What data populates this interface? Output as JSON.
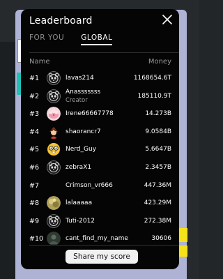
{
  "modal": {
    "title": "Leaderboard",
    "tabs": [
      {
        "label": "FOR YOU",
        "active": false
      },
      {
        "label": "GLOBAL",
        "active": true
      }
    ],
    "columns": {
      "name": "Name",
      "money": "Money"
    },
    "share_label": "Share my score"
  },
  "entries": [
    {
      "rank": "#1",
      "name": "lavas214",
      "sub": "",
      "money": "1168654.6T",
      "avatar": "panda-icon"
    },
    {
      "rank": "#2",
      "name": "Anasssssss",
      "sub": "Creator",
      "money": "185110.9T",
      "avatar": "panda-icon"
    },
    {
      "rank": "#3",
      "name": "Irene66667778",
      "sub": "",
      "money": "14.273B",
      "avatar": "pink-cake-icon"
    },
    {
      "rank": "#4",
      "name": "shaorancr7",
      "sub": "",
      "money": "9.0584B",
      "avatar": "character-icon"
    },
    {
      "rank": "#5",
      "name": "Nerd_Guy",
      "sub": "",
      "money": "5.6647B",
      "avatar": "nerd-emoji-icon"
    },
    {
      "rank": "#6",
      "name": "zebraX1",
      "sub": "",
      "money": "2.3457B",
      "avatar": "panda-icon"
    },
    {
      "rank": "#7",
      "name": "Crimson_vr666",
      "sub": "",
      "money": "447.36M",
      "avatar": "none"
    },
    {
      "rank": "#8",
      "name": "lalaaaaa",
      "sub": "",
      "money": "423.29M",
      "avatar": "photo-icon"
    },
    {
      "rank": "#9",
      "name": "Tuti-2012",
      "sub": "",
      "money": "272.38M",
      "avatar": "panda-icon"
    },
    {
      "rank": "#10",
      "name": "cant_find_my_name",
      "sub": "",
      "money": "30606",
      "avatar": "photo-dark-icon"
    }
  ],
  "colors": {
    "modal_bg": "#050505",
    "button_bg": "#f1f1f1",
    "background_frame": "#aeb3d6",
    "accent_teal": "#1fc0b5",
    "accent_yellow": "#f5e21a"
  }
}
